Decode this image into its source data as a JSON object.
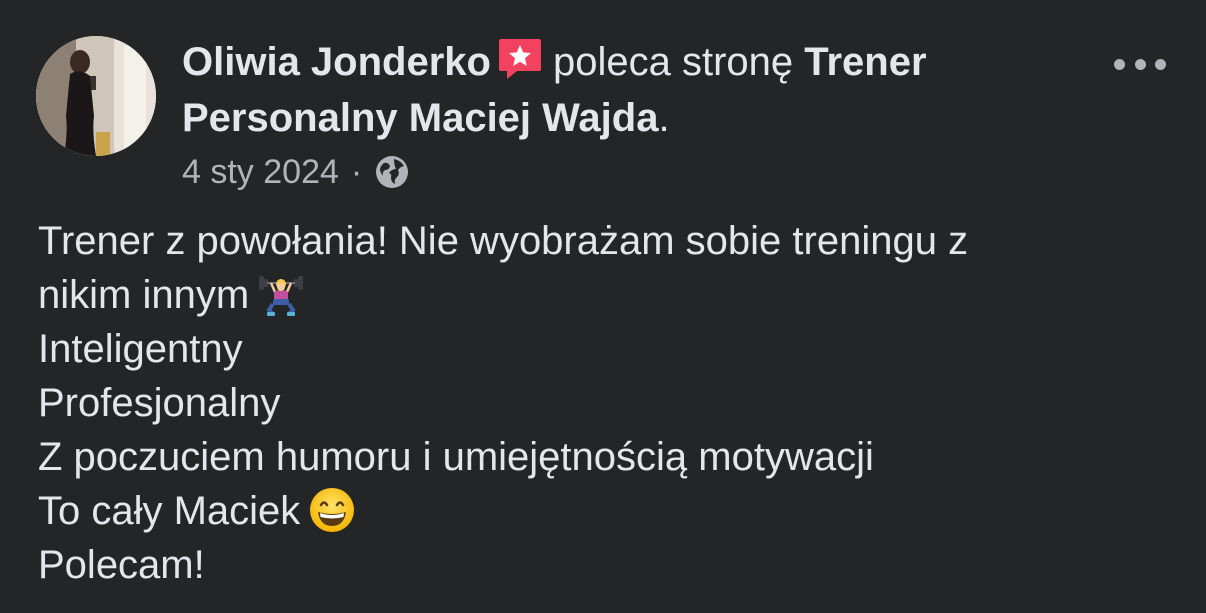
{
  "post": {
    "author": "Oliwia Jonderko",
    "action": "poleca stronę",
    "page_name": "Trener Personalny Maciej Wajda",
    "page_name_suffix": ".",
    "date": "4 sty 2024",
    "separator": "·",
    "privacy_icon": "globe-icon",
    "recommendation_icon": "recommendation-star-icon",
    "more_icon": "more-options-icon",
    "lines": [
      "Trener z powołania! Nie wyobrażam sobie treningu z",
      "nikim innym",
      "Inteligentny",
      "Profesjonalny",
      "Z poczuciem humoru i umiejętnością motywacji",
      "To cały Maciek",
      "Polecam!"
    ],
    "emojis": {
      "line2": "weightlifter-emoji",
      "line6": "grinning-face-emoji"
    }
  },
  "colors": {
    "background": "#242526",
    "primary_text": "#e4e6eb",
    "secondary_text": "#b0b3b8",
    "recommend_badge": "#f3425f"
  }
}
